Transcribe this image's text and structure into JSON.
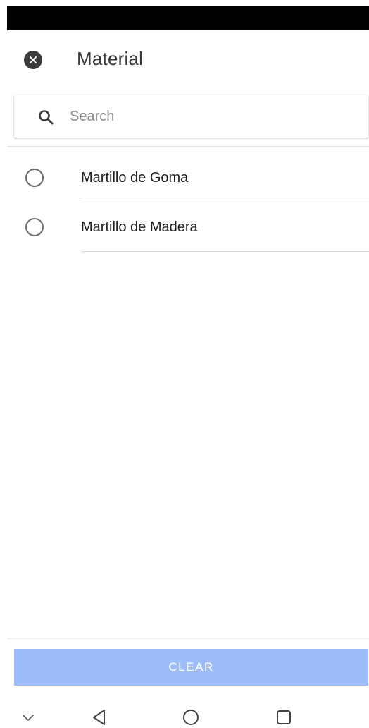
{
  "header": {
    "title": "Material"
  },
  "search": {
    "placeholder": "Search",
    "value": ""
  },
  "list": {
    "items": [
      {
        "label": "Martillo de Goma",
        "selected": false
      },
      {
        "label": "Martillo de Madera",
        "selected": false
      }
    ]
  },
  "footer": {
    "clear_label": "CLEAR",
    "clear_color": "#9dbcf8"
  },
  "nav": {
    "icons": [
      "chevron-down-icon",
      "back-icon",
      "home-icon",
      "recents-icon"
    ]
  }
}
